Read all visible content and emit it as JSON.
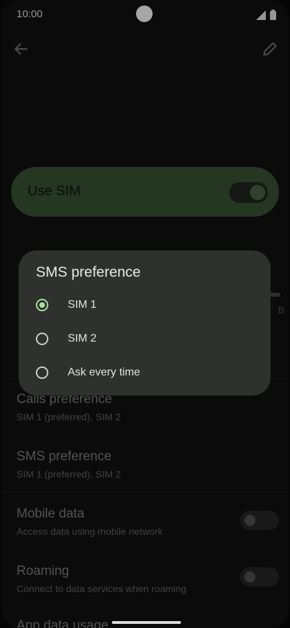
{
  "status_bar": {
    "time": "10:00"
  },
  "use_sim": {
    "label": "Use SIM",
    "enabled": true
  },
  "background_peek": {
    "right_unit": "B"
  },
  "dialog": {
    "title": "SMS preference",
    "options": [
      {
        "label": "SIM 1",
        "selected": true
      },
      {
        "label": "SIM 2",
        "selected": false
      },
      {
        "label": "Ask every time",
        "selected": false
      }
    ]
  },
  "settings": {
    "calls": {
      "title": "Calls preference",
      "subtitle": "SIM 1 (preferred), SIM 2"
    },
    "sms": {
      "title": "SMS preference",
      "subtitle": "SIM 1 (preferred), SIM 2"
    },
    "mobile_data": {
      "title": "Mobile data",
      "subtitle": "Access data using mobile network",
      "enabled": false
    },
    "roaming": {
      "title": "Roaming",
      "subtitle": "Connect to data services when roaming",
      "enabled": false
    },
    "app_data_usage": {
      "title": "App data usage"
    }
  },
  "colors": {
    "accent": "#a9e2a0",
    "use_sim_bg": "#5c8a55",
    "dialog_bg": "#2e312d"
  },
  "icons": {
    "back": "arrow-back-icon",
    "edit": "pencil-icon"
  }
}
